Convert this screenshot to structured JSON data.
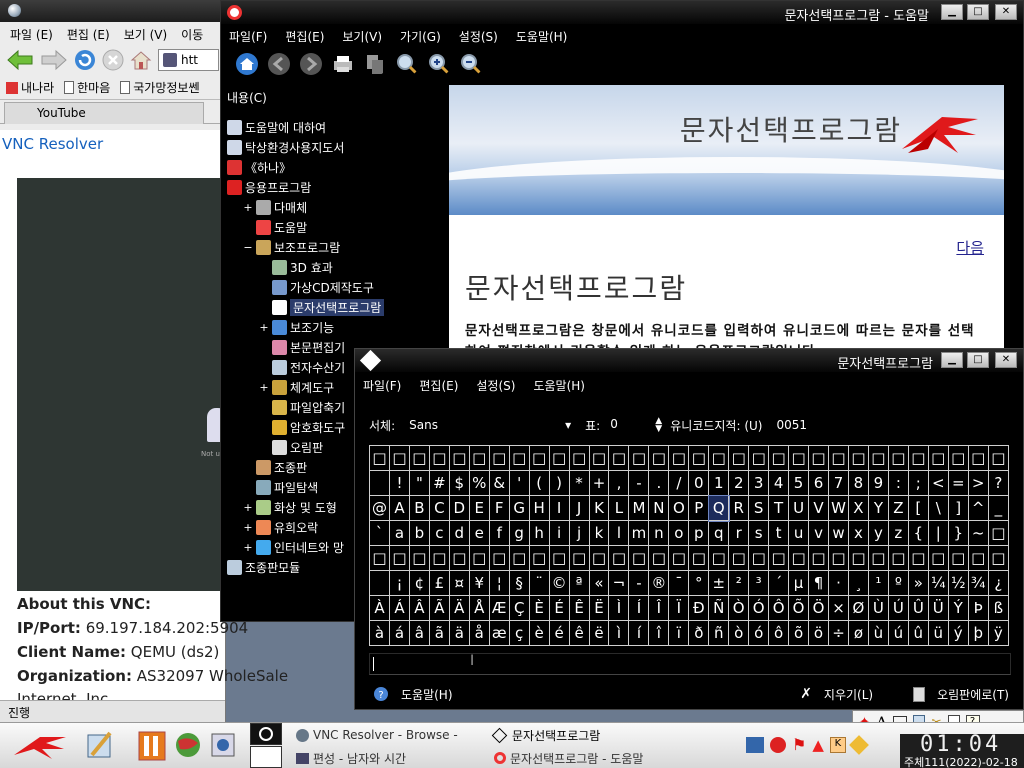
{
  "browser": {
    "menu": [
      "파일 (E)",
      "편집 (E)",
      "보기 (V)",
      "이동"
    ],
    "url": "htt",
    "bookmarks": [
      "내나라",
      "한마음",
      "국가망정보쎈"
    ],
    "tab": "YouTube",
    "page_link": "VNC Resolver",
    "shot_caption": "Not u",
    "info": [
      {
        "label": "About this VNC:",
        "value": ""
      },
      {
        "label": "IP/Port:",
        "value": "69.197.184.202:5904"
      },
      {
        "label": "Client Name:",
        "value": "QEMU (ds2)"
      },
      {
        "label": "Organization:",
        "value": "AS32097 WholeSale"
      },
      {
        "label": "",
        "value": "Internet, Inc."
      }
    ],
    "status": "진행"
  },
  "help": {
    "title": "문자선택프로그람 - 도움말",
    "menu": [
      "파일(F)",
      "편집(E)",
      "보기(V)",
      "가기(G)",
      "설정(S)",
      "도움말(H)"
    ],
    "content_label": "내용(C)",
    "tree": [
      {
        "label": "도움말에 대하여",
        "indent": 0,
        "expander": "",
        "icon": "book-icon",
        "color": "#cfd8e8"
      },
      {
        "label": "탁상환경사용지도서",
        "indent": 0,
        "expander": "",
        "icon": "book-icon",
        "color": "#cfd8e8"
      },
      {
        "label": "《하나》",
        "indent": 0,
        "expander": "",
        "icon": "flag-icon",
        "color": "#d33"
      },
      {
        "label": "응용프로그람",
        "indent": 0,
        "expander": "",
        "icon": "star-icon",
        "color": "#d22"
      },
      {
        "label": "다매체",
        "indent": 1,
        "expander": "+",
        "icon": "media-icon",
        "color": "#aaa"
      },
      {
        "label": "도움말",
        "indent": 1,
        "expander": "",
        "icon": "help-icon",
        "color": "#e44"
      },
      {
        "label": "보조프로그람",
        "indent": 1,
        "expander": "−",
        "icon": "tools-icon",
        "color": "#caa55a"
      },
      {
        "label": "3D 효과",
        "indent": 2,
        "expander": "",
        "icon": "3d-icon",
        "color": "#9b9"
      },
      {
        "label": "가상CD제작도구",
        "indent": 2,
        "expander": "",
        "icon": "cd-icon",
        "color": "#79c"
      },
      {
        "label": "문자선택프로그람",
        "indent": 2,
        "expander": "",
        "icon": "charmap-icon",
        "color": "#fff",
        "selected": true
      },
      {
        "label": "보조기능",
        "indent": 2,
        "expander": "+",
        "icon": "accessibility-icon",
        "color": "#4a8ad8"
      },
      {
        "label": "본문편집기",
        "indent": 2,
        "expander": "",
        "icon": "editor-icon",
        "color": "#d8a"
      },
      {
        "label": "전자수산기",
        "indent": 2,
        "expander": "",
        "icon": "calculator-icon",
        "color": "#bcd"
      },
      {
        "label": "체계도구",
        "indent": 2,
        "expander": "+",
        "icon": "system-icon",
        "color": "#c9a23c"
      },
      {
        "label": "파일압축기",
        "indent": 2,
        "expander": "",
        "icon": "archive-icon",
        "color": "#d9b54a"
      },
      {
        "label": "암호화도구",
        "indent": 2,
        "expander": "",
        "icon": "key-icon",
        "color": "#e0b030"
      },
      {
        "label": "오림판",
        "indent": 2,
        "expander": "",
        "icon": "clipboard-icon",
        "color": "#ddd"
      },
      {
        "label": "조종판",
        "indent": 1,
        "expander": "",
        "icon": "control-icon",
        "color": "#c96"
      },
      {
        "label": "파일탐색",
        "indent": 1,
        "expander": "",
        "icon": "file-browser-icon",
        "color": "#8ab"
      },
      {
        "label": "화상 및 도형",
        "indent": 1,
        "expander": "+",
        "icon": "graphics-icon",
        "color": "#ac8"
      },
      {
        "label": "유희오락",
        "indent": 1,
        "expander": "+",
        "icon": "games-icon",
        "color": "#e85"
      },
      {
        "label": "인터네트와 망",
        "indent": 1,
        "expander": "+",
        "icon": "internet-icon",
        "color": "#4ae"
      },
      {
        "label": "조종판모듈",
        "indent": 0,
        "expander": "",
        "icon": "module-icon",
        "color": "#bcd"
      }
    ],
    "banner_title": "문자선택프로그람",
    "next_link": "다음",
    "doc_title": "문자선택프로그람",
    "doc_para": "문자선택프로그람은 창문에서 유니코드를 입력하여 유니코드에 따르는 문자를 선택하여 편집창에서 리용할수 있게 하는 응용프로그람입니다."
  },
  "charmap": {
    "title": "문자선택프로그람",
    "menu": [
      "파일(F)",
      "편집(E)",
      "설정(S)",
      "도움말(H)"
    ],
    "font_label": "서체:",
    "font_value": "Sans",
    "table_label": "표:",
    "table_value": "0",
    "unicode_label": "유니코드지적: (U)",
    "unicode_value": "0051",
    "rows": [
      [
        "□",
        "□",
        "□",
        "□",
        "□",
        "□",
        "□",
        "□",
        "□",
        "□",
        "□",
        "□",
        "□",
        "□",
        "□",
        "□",
        "□",
        "□",
        "□",
        "□",
        "□",
        "□",
        "□",
        "□",
        "□",
        "□",
        "□",
        "□",
        "□",
        "□",
        "□",
        "□"
      ],
      [
        " ",
        "!",
        "\"",
        "#",
        "$",
        "%",
        "&",
        "'",
        "(",
        ")",
        "*",
        "+",
        ",",
        "-",
        ".",
        "/",
        "0",
        "1",
        "2",
        "3",
        "4",
        "5",
        "6",
        "7",
        "8",
        "9",
        ":",
        ";",
        "<",
        "=",
        ">",
        "?"
      ],
      [
        "@",
        "A",
        "B",
        "C",
        "D",
        "E",
        "F",
        "G",
        "H",
        "I",
        "J",
        "K",
        "L",
        "M",
        "N",
        "O",
        "P",
        "Q",
        "R",
        "S",
        "T",
        "U",
        "V",
        "W",
        "X",
        "Y",
        "Z",
        "[",
        "\\",
        "]",
        "^",
        "_"
      ],
      [
        "`",
        "a",
        "b",
        "c",
        "d",
        "e",
        "f",
        "g",
        "h",
        "i",
        "j",
        "k",
        "l",
        "m",
        "n",
        "o",
        "p",
        "q",
        "r",
        "s",
        "t",
        "u",
        "v",
        "w",
        "x",
        "y",
        "z",
        "{",
        "|",
        "}",
        "~",
        "□"
      ],
      [
        "□",
        "□",
        "□",
        "□",
        "□",
        "□",
        "□",
        "□",
        "□",
        "□",
        "□",
        "□",
        "□",
        "□",
        "□",
        "□",
        "□",
        "□",
        "□",
        "□",
        "□",
        "□",
        "□",
        "□",
        "□",
        "□",
        "□",
        "□",
        "□",
        "□",
        "□",
        "□"
      ],
      [
        " ",
        "¡",
        "¢",
        "£",
        "¤",
        "¥",
        "¦",
        "§",
        "¨",
        "©",
        "ª",
        "«",
        "¬",
        "-",
        "®",
        "¯",
        "°",
        "±",
        "²",
        "³",
        "´",
        "µ",
        "¶",
        "·",
        "¸",
        "¹",
        "º",
        "»",
        "¼",
        "½",
        "¾",
        "¿"
      ],
      [
        "À",
        "Á",
        "Â",
        "Ã",
        "Ä",
        "Å",
        "Æ",
        "Ç",
        "È",
        "É",
        "Ê",
        "Ë",
        "Ì",
        "Í",
        "Î",
        "Ï",
        "Ð",
        "Ñ",
        "Ò",
        "Ó",
        "Ô",
        "Õ",
        "Ö",
        "×",
        "Ø",
        "Ù",
        "Ú",
        "Û",
        "Ü",
        "Ý",
        "Þ",
        "ß"
      ],
      [
        "à",
        "á",
        "â",
        "ã",
        "ä",
        "å",
        "æ",
        "ç",
        "è",
        "é",
        "ê",
        "ë",
        "ì",
        "í",
        "î",
        "ï",
        "ð",
        "ñ",
        "ò",
        "ó",
        "ô",
        "õ",
        "ö",
        "÷",
        "ø",
        "ù",
        "ú",
        "û",
        "ü",
        "ý",
        "þ",
        "ÿ"
      ]
    ],
    "selected_char": "Q",
    "help_button": "도움말(H)",
    "clear_button": "지우기(L)",
    "copy_button": "오림판에로(T)"
  },
  "taskbar": {
    "tasks": [
      {
        "label": "VNC Resolver - Browse -",
        "icon": "browser-icon",
        "active": false
      },
      {
        "label": "문자선택프로그람",
        "icon": "charmap-icon",
        "active": true
      },
      {
        "label": "편성 - 남자와 시간",
        "icon": "tv-icon",
        "active": false
      },
      {
        "label": "문자선택프로그람 - 도움말",
        "icon": "help-icon",
        "active": false
      }
    ],
    "clock_time": "01:04",
    "clock_date": "주체111(2022)-02-18"
  }
}
